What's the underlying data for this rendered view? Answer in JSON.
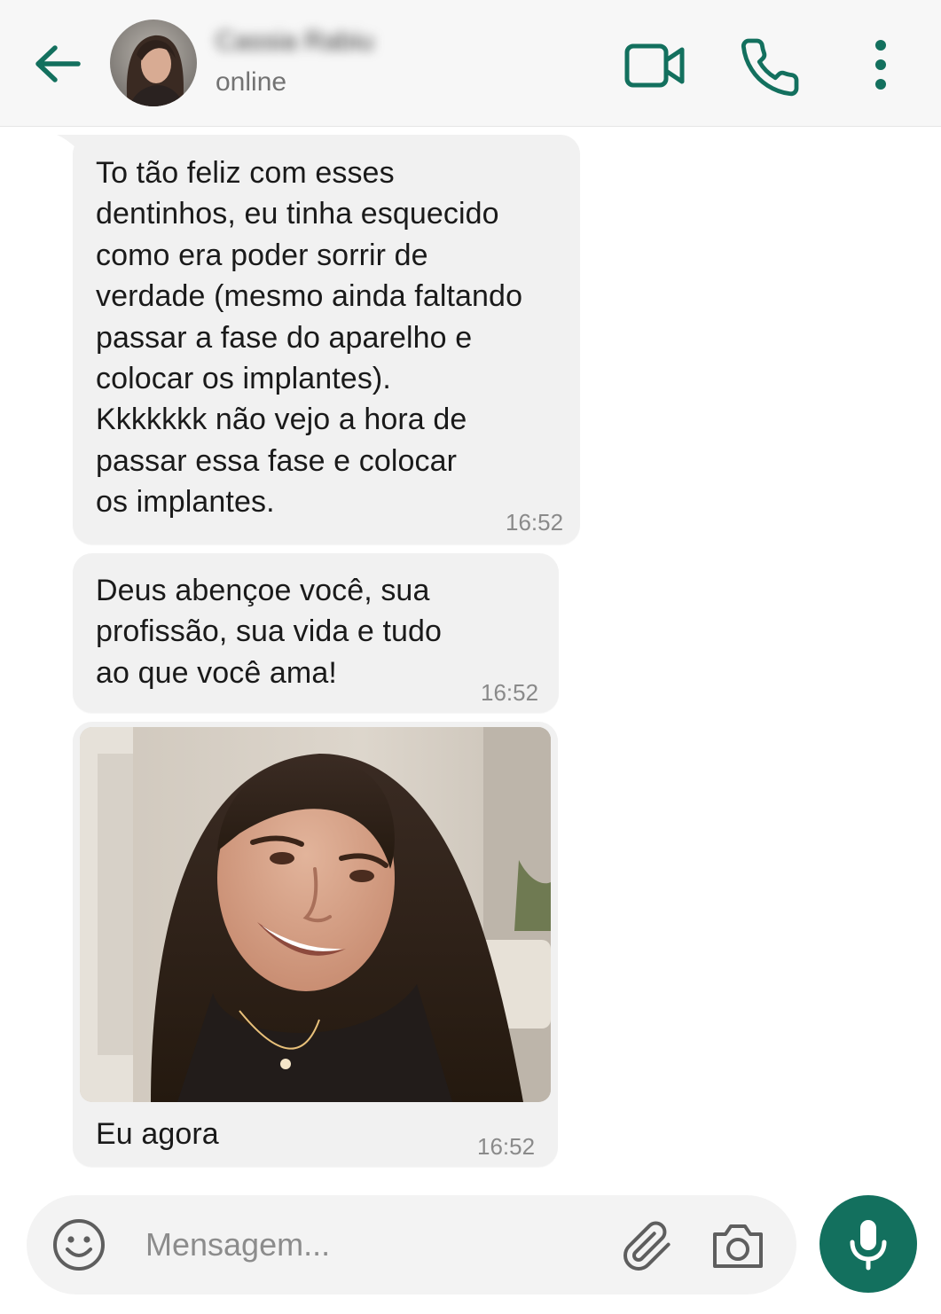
{
  "colors": {
    "accent": "#13705e",
    "bubble": "#f1f1f1",
    "header_bg": "#f7f7f7"
  },
  "header": {
    "back_icon": "arrow-left-icon",
    "contact_name": "Cassia Rabiu",
    "contact_status": "online",
    "video_icon": "video-camera-icon",
    "call_icon": "phone-icon",
    "menu_icon": "more-vertical-icon"
  },
  "messages": [
    {
      "type": "text",
      "text": "To tão feliz com esses\ndentinhos, eu tinha esquecido\ncomo era poder sorrir de\nverdade (mesmo ainda faltando\npassar a fase do aparelho e\ncolocar os implantes).\nKkkkkkk não vejo a hora de\npassar essa fase e colocar\nos implantes.",
      "time": "16:52"
    },
    {
      "type": "text",
      "text": "Deus abençoe você, sua\nprofissão, sua vida e tudo\nao que você ama!",
      "time": "16:52"
    },
    {
      "type": "image",
      "caption": "Eu agora",
      "time": "16:52"
    }
  ],
  "composer": {
    "placeholder": "Mensagem...",
    "emoji_icon": "emoji-icon",
    "attach_icon": "paperclip-icon",
    "camera_icon": "camera-icon",
    "mic_icon": "microphone-icon"
  }
}
